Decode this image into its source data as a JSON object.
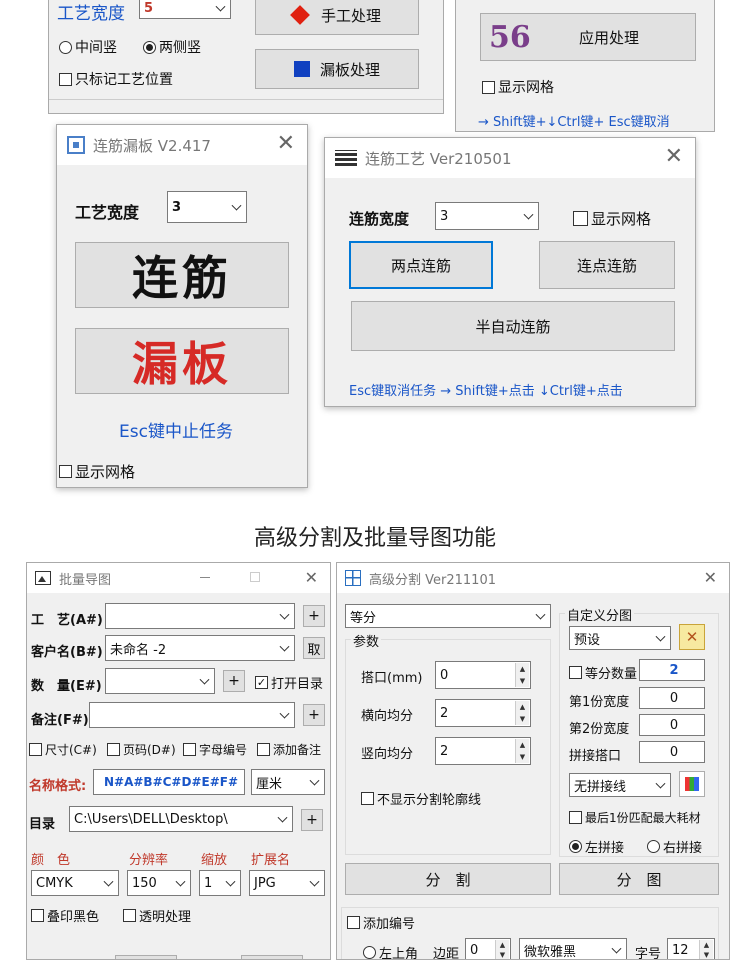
{
  "top_left": {
    "craft_width_label": "工艺宽度",
    "craft_width_value": "5",
    "radio_middle": "中间竖",
    "radio_both": "两侧竖",
    "mark_only": "只标记工艺位置",
    "manual_btn": "手工处理",
    "leak_btn": "漏板处理"
  },
  "top_right": {
    "number": "56",
    "apply_btn": "应用处理",
    "show_grid": "显示网格",
    "hint": "→ Shift键+↓Ctrl键+ Esc键取消"
  },
  "lianjin_win": {
    "title": "连筋漏板 V2.417",
    "close": "✕",
    "width_label": "工艺宽度",
    "width_value": "3",
    "big_btn1": "连筋",
    "big_btn2": "漏板",
    "esc_hint": "Esc键中止任务",
    "show_grid": "显示网格"
  },
  "lianjin_craft_win": {
    "title": "连筋工艺 Ver210501",
    "close": "✕",
    "width_label": "连筋宽度",
    "width_value": "3",
    "show_grid": "显示网格",
    "btn_two_point": "两点连筋",
    "btn_multi_point": "连点连筋",
    "btn_semi_auto": "半自动连筋",
    "hint": "Esc键取消任务 → Shift键+点击 ↓Ctrl键+点击"
  },
  "section_title": "高级分割及批量导图功能",
  "batch_win": {
    "title": "批量导图",
    "close": "✕",
    "craft_label": "工　艺(A#)",
    "customer_label": "客户名(B#)",
    "customer_value": "未命名 -2",
    "fetch_btn": "取",
    "qty_label": "数　量(E#)",
    "open_dir": "打开目录",
    "remark_label": "备注(F#)",
    "opt_size": "尺寸(C#)",
    "opt_page": "页码(D#)",
    "opt_letter": "字母编号",
    "opt_remark": "添加备注",
    "name_format_label": "名称格式:",
    "name_format_value": "N#A#B#C#D#E#F#",
    "unit": "厘米",
    "dir_label": "目录",
    "dir_value": "C:\\Users\\DELL\\Desktop\\",
    "color_label": "颜　色",
    "dpi_label": "分辨率",
    "scale_label": "缩放",
    "ext_label": "扩展名",
    "color_value": "CMYK",
    "dpi_value": "150",
    "scale_value": "1",
    "ext_value": "JPG",
    "overprint": "叠印黑色",
    "transparent": "透明处理",
    "plus": "+"
  },
  "split_win": {
    "title": "高级分割 Ver211101",
    "close": "✕",
    "mode_value": "等分",
    "params_label": "参数",
    "overlap_label": "搭口(mm)",
    "overlap_value": "0",
    "h_split_label": "横向均分",
    "h_split_value": "2",
    "v_split_label": "竖向均分",
    "v_split_value": "2",
    "hide_outline": "不显示分割轮廓线",
    "split_btn": "分　割",
    "custom_label": "自定义分图",
    "preset_value": "预设",
    "equal_count_label": "等分数量",
    "equal_count_value": "2",
    "first_width_label": "第1份宽度",
    "first_width_value": "0",
    "second_width_label": "第2份宽度",
    "second_width_value": "0",
    "join_overlap_label": "拼接搭口",
    "join_overlap_value": "0",
    "join_line_value": "无拼接线",
    "last_max": "最后1份匹配最大耗材",
    "left_join": "左拼接",
    "right_join": "右拼接",
    "split_img_btn": "分　图",
    "add_number": "添加编号",
    "top_left_corner": "左上角",
    "margin_label": "边距",
    "margin_value": "0",
    "font_value": "微软雅黑",
    "font_size_label": "字号",
    "font_size_value": "12"
  }
}
